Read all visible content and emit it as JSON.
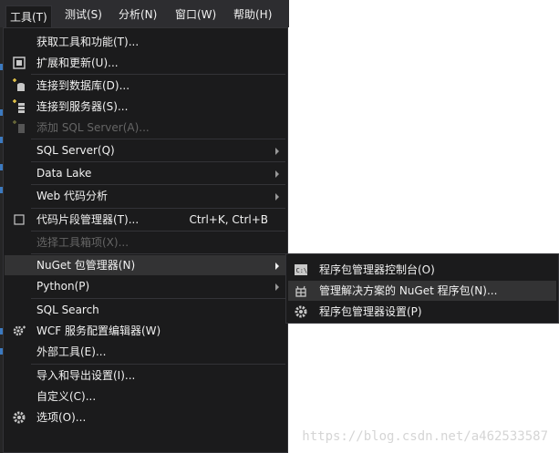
{
  "menubar": {
    "items": [
      {
        "label": "工具(T)"
      },
      {
        "label": "测试(S)"
      },
      {
        "label": "分析(N)"
      },
      {
        "label": "窗口(W)"
      },
      {
        "label": "帮助(H)"
      }
    ]
  },
  "tools_menu": {
    "items": [
      {
        "label": "获取工具和功能(T)..."
      },
      {
        "label": "扩展和更新(U)...",
        "icon": "extensions-icon"
      },
      {
        "label": "连接到数据库(D)...",
        "icon": "connect-database-icon"
      },
      {
        "label": "连接到服务器(S)...",
        "icon": "connect-server-icon"
      },
      {
        "label": "添加 SQL Server(A)...",
        "icon": "add-sql-server-icon"
      },
      {
        "label": "SQL Server(Q)"
      },
      {
        "label": "Data Lake"
      },
      {
        "label": "Web 代码分析"
      },
      {
        "label": "代码片段管理器(T)...",
        "shortcut": "Ctrl+K, Ctrl+B",
        "icon": "checkbox-icon"
      },
      {
        "label": "选择工具箱项(X)..."
      },
      {
        "label": "NuGet 包管理器(N)"
      },
      {
        "label": "Python(P)"
      },
      {
        "label": "SQL Search"
      },
      {
        "label": "WCF 服务配置编辑器(W)",
        "icon": "wcf-gear-icon"
      },
      {
        "label": "外部工具(E)..."
      },
      {
        "label": "导入和导出设置(I)..."
      },
      {
        "label": "自定义(C)..."
      },
      {
        "label": "选项(O)...",
        "icon": "gear-icon"
      }
    ]
  },
  "nuget_submenu": {
    "items": [
      {
        "label": "程序包管理器控制台(O)",
        "icon": "console-icon"
      },
      {
        "label": "管理解决方案的 NuGet 程序包(N)...",
        "icon": "package-icon"
      },
      {
        "label": "程序包管理器设置(P)",
        "icon": "gear-icon"
      }
    ]
  },
  "watermark": "https://blog.csdn.net/a462533587",
  "colors": {
    "menu_bg": "#1b1b1c",
    "menubar_bg": "#2d2d30",
    "hover_bg": "#333334",
    "text": "#f1f1f1",
    "disabled_text": "#656565"
  }
}
